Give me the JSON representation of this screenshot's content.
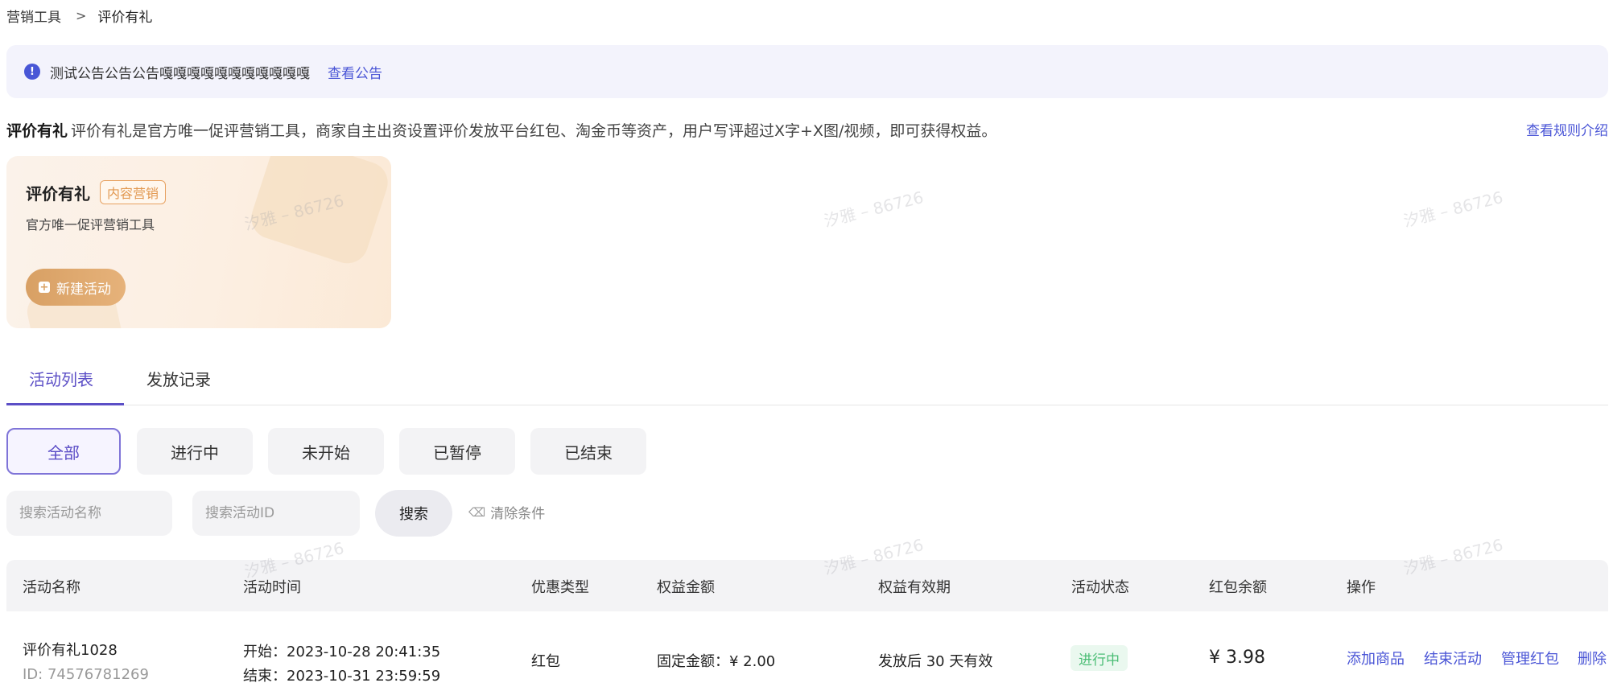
{
  "breadcrumb": {
    "parent": "营销工具",
    "separator": ">",
    "current": "评价有礼"
  },
  "notice": {
    "text": "测试公告公告公告嘎嘎嘎嘎嘎嘎嘎嘎嘎嘎嘎",
    "link": "查看公告"
  },
  "intro": {
    "title": "评价有礼",
    "description": "评价有礼是官方唯一促评营销工具，商家自主出资设置评价发放平台红包、淘金币等资产，用户写评超过X字+X图/视频，即可获得权益。",
    "rules_link": "查看规则介绍"
  },
  "card": {
    "title": "评价有礼",
    "tag": "内容营销",
    "subtitle": "官方唯一促评营销工具",
    "new_button": "新建活动"
  },
  "tabs": [
    {
      "label": "活动列表",
      "active": true
    },
    {
      "label": "发放记录",
      "active": false
    }
  ],
  "filters": [
    {
      "label": "全部",
      "active": true
    },
    {
      "label": "进行中",
      "active": false
    },
    {
      "label": "未开始",
      "active": false
    },
    {
      "label": "已暂停",
      "active": false
    },
    {
      "label": "已结束",
      "active": false
    }
  ],
  "search": {
    "name_placeholder": "搜索活动名称",
    "id_placeholder": "搜索活动ID",
    "search_button": "搜索",
    "clear_button": "清除条件"
  },
  "table": {
    "headers": [
      "活动名称",
      "活动时间",
      "优惠类型",
      "权益金额",
      "权益有效期",
      "活动状态",
      "红包余额",
      "操作"
    ],
    "rows": [
      {
        "name": "评价有礼1028",
        "id": "ID: 74576781269",
        "start": "开始：2023-10-28 20:41:35",
        "end": "结束：2023-10-31 23:59:59",
        "type": "红包",
        "amount": "固定金额：¥ 2.00",
        "validity": "发放后 30 天有效",
        "status": "进行中",
        "balance": "¥ 3.98",
        "ops": [
          "添加商品",
          "结束活动",
          "管理红包",
          "删除"
        ]
      }
    ]
  },
  "watermark": "汐雅 – 86726",
  "colors": {
    "accent": "#5b4ec6",
    "link": "#4a55d6",
    "status_green": "#4bbd75",
    "card_button": "#dea46a"
  }
}
